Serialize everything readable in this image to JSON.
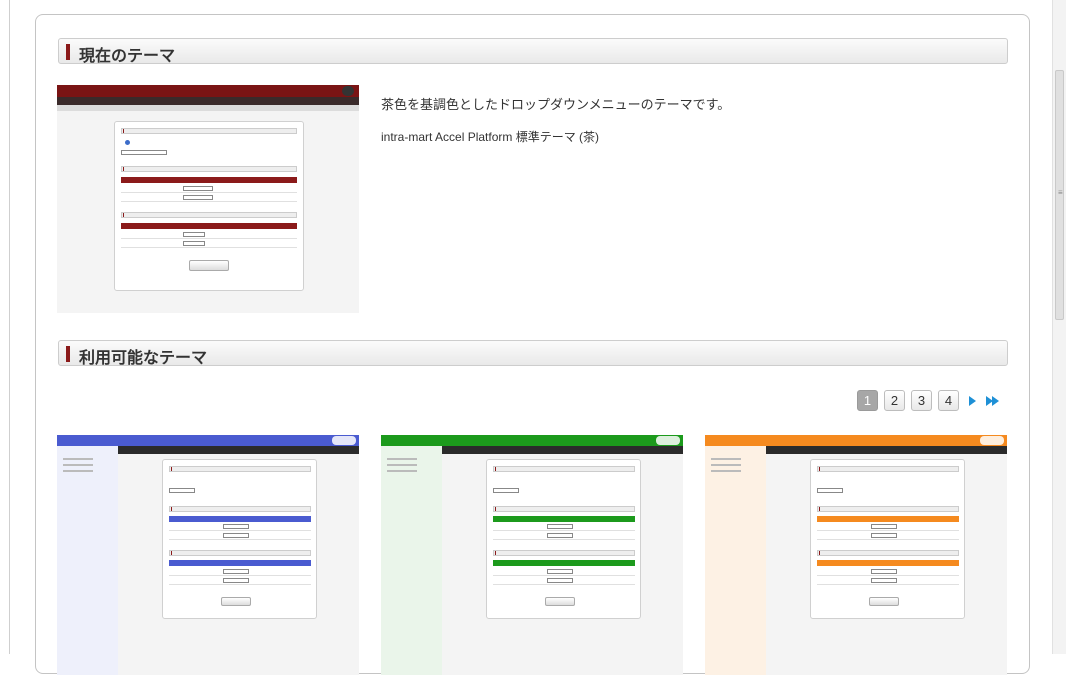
{
  "current_section": {
    "title": "現在のテーマ"
  },
  "current_theme": {
    "description": "茶色を基調色としたドロップダウンメニューのテーマです。",
    "name": "intra-mart Accel Platform 標準テーマ (茶)"
  },
  "available_section": {
    "title": "利用可能なテーマ"
  },
  "pager": {
    "pages": [
      "1",
      "2",
      "3",
      "4"
    ],
    "active_page": "1"
  },
  "theme_colors": {
    "current": "#8b1a1a",
    "blue": "#4a5bd0",
    "green": "#1c9a1c",
    "orange": "#f58a1f"
  },
  "icons": [
    "next-page-icon",
    "last-page-icon"
  ]
}
